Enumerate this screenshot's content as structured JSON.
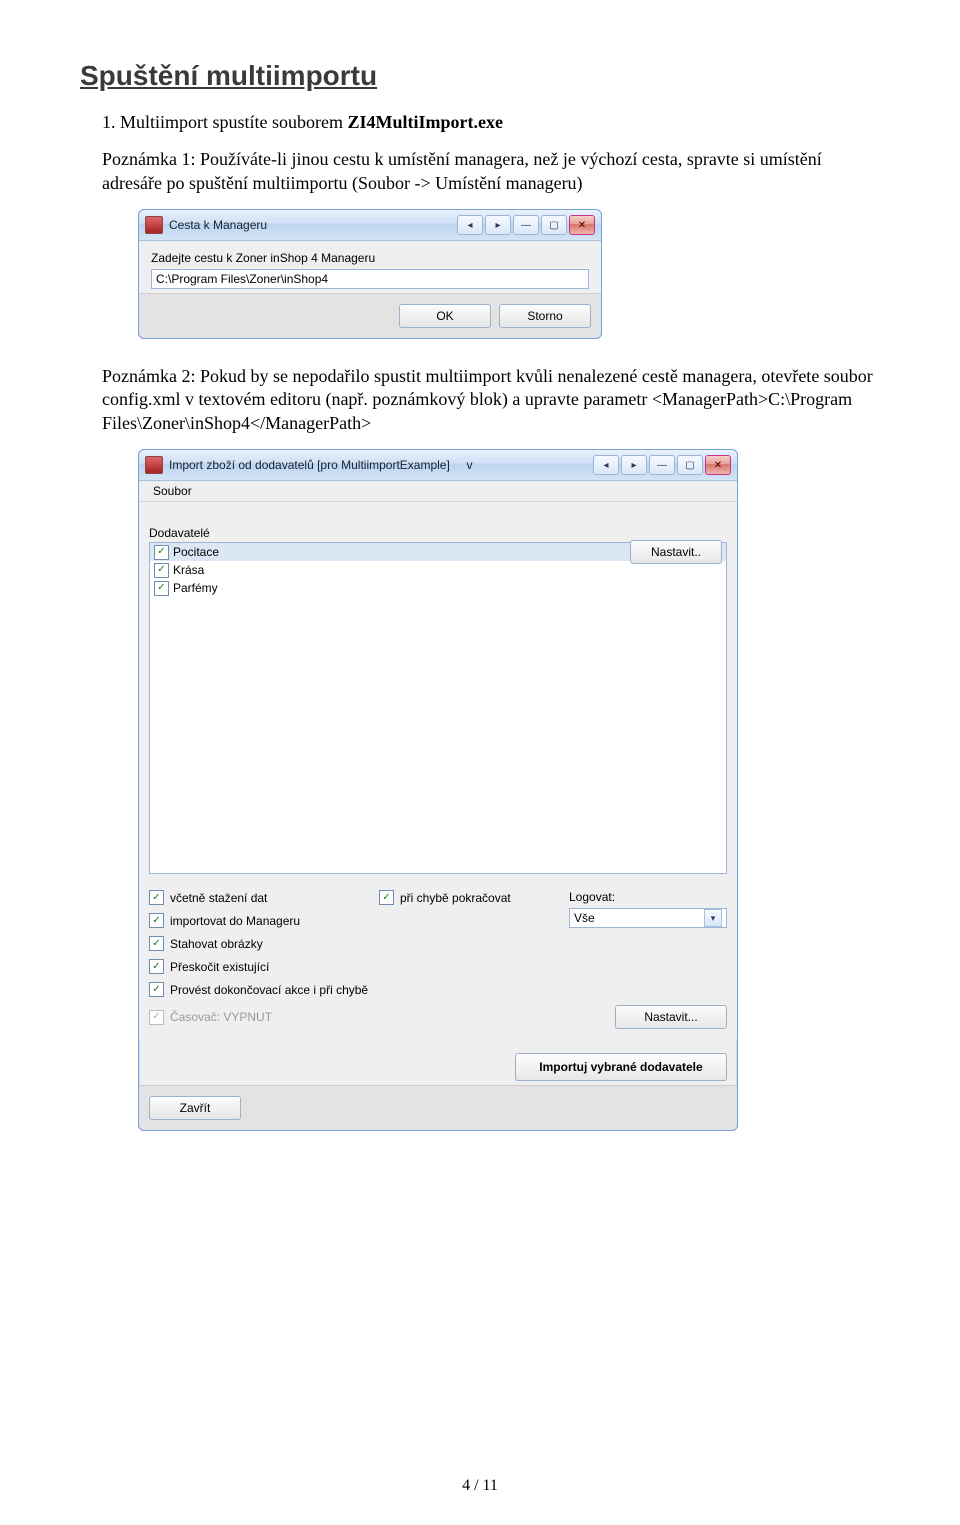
{
  "section_title": "Spuštění multiimportu",
  "list": {
    "num": "1.",
    "prefix": "Multiimport spustíte souborem ",
    "bold": "ZI4MultiImport.exe"
  },
  "note1": "Poznámka 1: Používáte-li jinou cestu k umístění managera, než je výchozí cesta, spravte si umístění adresáře po spuštění multiimportu (Soubor -> Umístění manageru)",
  "dialog1": {
    "title": "Cesta k Manageru",
    "label": "Zadejte cestu k Zoner inShop 4 Manageru",
    "value": "C:\\Program Files\\Zoner\\inShop4",
    "ok": "OK",
    "cancel": "Storno"
  },
  "note2": "Poznámka 2: Pokud by se nepodařilo spustit multiimport kvůli nenalezené cestě managera, otevřete soubor config.xml v textovém editoru (např. poznámkový blok) a upravte parametr <ManagerPath>C:\\Program Files\\Zoner\\inShop4</ManagerPath>",
  "dialog2": {
    "title_prefix": "Import zboží od dodavatelů [pro MultiimportExample]",
    "title_v": "v",
    "menu": {
      "soubor": "Soubor"
    },
    "suppliers_label": "Dodavatelé",
    "suppliers": [
      {
        "name": "Pocitace",
        "checked": true,
        "selected": true,
        "button": "Nastavit.."
      },
      {
        "name": "Krása",
        "checked": true,
        "selected": false
      },
      {
        "name": "Parfémy",
        "checked": true,
        "selected": false
      }
    ],
    "opts_left": [
      {
        "label": "včetně stažení dat",
        "checked": true
      },
      {
        "label": "importovat do Manageru",
        "checked": true
      },
      {
        "label": "Stahovat obrázky",
        "checked": true
      },
      {
        "label": "Přeskočit existující",
        "checked": true
      },
      {
        "label": "Provést dokončovací akce i při chybě",
        "checked": true
      }
    ],
    "opt_mid": {
      "label": "při chybě pokračovat",
      "checked": true
    },
    "log_label": "Logovat:",
    "log_value": "Vše",
    "timer": {
      "label": "Časovač: VYPNUT",
      "checked": true,
      "disabled": true,
      "button": "Nastavit..."
    },
    "import_btn": "Importuj vybrané dodavatele",
    "close_btn": "Zavřít"
  },
  "page_num": "4 / 11"
}
